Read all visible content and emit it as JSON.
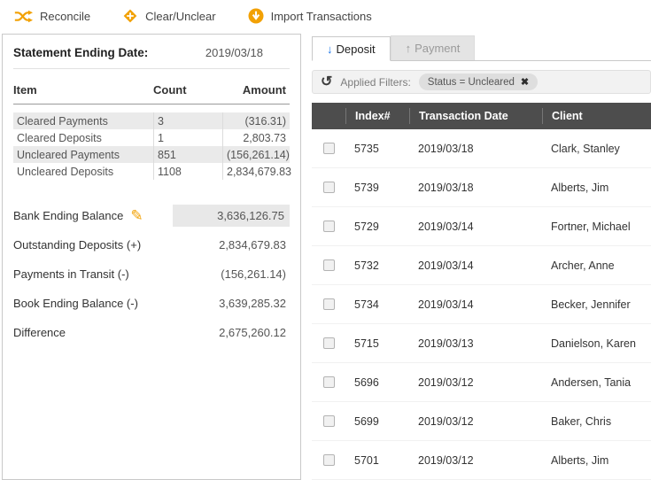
{
  "toolbar": {
    "reconcile": "Reconcile",
    "clear_unclear": "Clear/Unclear",
    "import_transactions": "Import Transactions"
  },
  "summary_panel": {
    "statement_label": "Statement Ending Date:",
    "statement_date": "2019/03/18",
    "columns": {
      "item": "Item",
      "count": "Count",
      "amount": "Amount"
    },
    "rows": [
      {
        "item": "Cleared Payments",
        "count": "3",
        "amount": "(316.31)"
      },
      {
        "item": "Cleared Deposits",
        "count": "1",
        "amount": "2,803.73"
      },
      {
        "item": "Uncleared Payments",
        "count": "851",
        "amount": "(156,261.14)"
      },
      {
        "item": "Uncleared Deposits",
        "count": "1108",
        "amount": "2,834,679.83"
      }
    ],
    "totals": [
      {
        "label": "Bank Ending Balance",
        "value": "3,636,126.75"
      },
      {
        "label": "Outstanding Deposits (+)",
        "value": "2,834,679.83"
      },
      {
        "label": "Payments in Transit (-)",
        "value": "(156,261.14)"
      },
      {
        "label": "Book Ending Balance (-)",
        "value": "3,639,285.32"
      },
      {
        "label": "Difference",
        "value": "2,675,260.12"
      }
    ]
  },
  "tabs": {
    "deposit": {
      "label": "Deposit",
      "arrow": "↓"
    },
    "payment": {
      "label": "Payment",
      "arrow": "↑"
    }
  },
  "filters": {
    "label": "Applied Filters:",
    "pill": {
      "text": "Status = Uncleared",
      "close": "✖"
    }
  },
  "transactions": {
    "columns": {
      "index": "Index#",
      "date": "Transaction Date",
      "client": "Client"
    },
    "rows": [
      {
        "index": "5735",
        "date": "2019/03/18",
        "client": "Clark, Stanley"
      },
      {
        "index": "5739",
        "date": "2019/03/18",
        "client": "Alberts, Jim"
      },
      {
        "index": "5729",
        "date": "2019/03/14",
        "client": "Fortner, Michael"
      },
      {
        "index": "5732",
        "date": "2019/03/14",
        "client": "Archer, Anne"
      },
      {
        "index": "5734",
        "date": "2019/03/14",
        "client": "Becker, Jennifer"
      },
      {
        "index": "5715",
        "date": "2019/03/13",
        "client": "Danielson, Karen"
      },
      {
        "index": "5696",
        "date": "2019/03/12",
        "client": "Andersen, Tania"
      },
      {
        "index": "5699",
        "date": "2019/03/12",
        "client": "Baker, Chris"
      },
      {
        "index": "5701",
        "date": "2019/03/12",
        "client": "Alberts, Jim"
      }
    ]
  },
  "icons": {
    "edit_pencil": "✎",
    "refresh": "↺"
  },
  "colors": {
    "accent_orange": "#F2A104",
    "table_header_dark": "#4D4D4D",
    "deposit_arrow_blue": "#1A73E8"
  }
}
